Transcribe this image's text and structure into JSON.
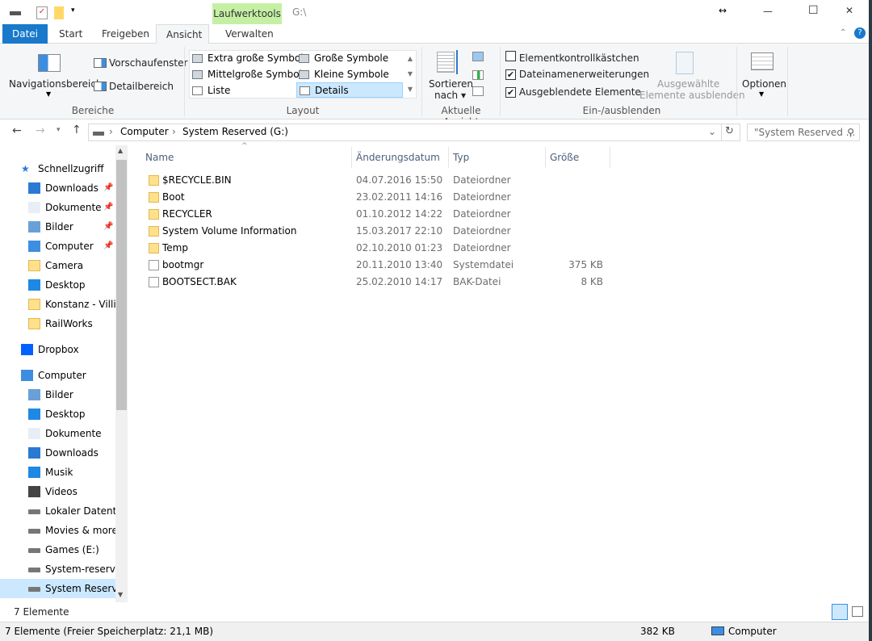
{
  "title_bar": {
    "context_tab": "Laufwerktools",
    "path": "G:\\",
    "resize_glyph": "↔",
    "minimize": "—",
    "maximize": "☐",
    "close": "✕"
  },
  "tabs": [
    {
      "label": "Datei"
    },
    {
      "label": "Start"
    },
    {
      "label": "Freigeben"
    },
    {
      "label": "Ansicht",
      "active": true
    },
    {
      "label": "Verwalten"
    }
  ],
  "ribbon": {
    "bereiche": {
      "label": "Bereiche",
      "navigationsbereich": "Navigationsbereich",
      "vorschaufenster": "Vorschaufenster",
      "detailbereich": "Detailbereich"
    },
    "layout": {
      "label": "Layout",
      "options": [
        "Extra große Symbole",
        "Große Symbole",
        "Mittelgroße Symbole",
        "Kleine Symbole",
        "Liste",
        "Details"
      ],
      "selected": "Details"
    },
    "aktuelle_ansicht": {
      "label": "Aktuelle Ansicht",
      "sortieren": "Sortieren",
      "nach": "nach ▾"
    },
    "einausblenden": {
      "label": "Ein-/ausblenden",
      "checkboxes": [
        {
          "label": "Elementkontrollkästchen",
          "checked": false
        },
        {
          "label": "Dateinamenerweiterungen",
          "checked": true
        },
        {
          "label": "Ausgeblendete Elemente",
          "checked": true
        }
      ],
      "hide_selected_1": "Ausgewählte",
      "hide_selected_2": "Elemente ausblenden"
    },
    "optionen": "Optionen"
  },
  "address": {
    "crumbs": [
      "Computer",
      "System Reserved (G:)"
    ],
    "search_placeholder": "\"System Reserved ..."
  },
  "nav": [
    {
      "label": "Schnellzugriff",
      "icon": "star-icon",
      "level": 0
    },
    {
      "label": "Downloads",
      "icon": "download-icon",
      "pinned": true
    },
    {
      "label": "Dokumente",
      "icon": "documents-icon",
      "pinned": true
    },
    {
      "label": "Bilder",
      "icon": "pictures-icon",
      "pinned": true
    },
    {
      "label": "Computer",
      "icon": "computer-icon",
      "pinned": true
    },
    {
      "label": "Camera",
      "icon": "folder-icon"
    },
    {
      "label": "Desktop",
      "icon": "desktop-icon"
    },
    {
      "label": "Konstanz - Villin",
      "icon": "folder-icon"
    },
    {
      "label": "RailWorks",
      "icon": "folder-icon"
    },
    {
      "label": "Dropbox",
      "icon": "dropbox-icon",
      "level": 0
    },
    {
      "label": "Computer",
      "icon": "computer-icon",
      "level": 0
    },
    {
      "label": "Bilder",
      "icon": "pictures-icon"
    },
    {
      "label": "Desktop",
      "icon": "desktop-icon"
    },
    {
      "label": "Dokumente",
      "icon": "documents-icon"
    },
    {
      "label": "Downloads",
      "icon": "download-icon"
    },
    {
      "label": "Musik",
      "icon": "music-icon"
    },
    {
      "label": "Videos",
      "icon": "videos-icon"
    },
    {
      "label": "Lokaler Datenträ",
      "icon": "drive-icon"
    },
    {
      "label": "Movies & more",
      "icon": "drive-icon"
    },
    {
      "label": "Games (E:)",
      "icon": "drive-icon"
    },
    {
      "label": "System-reservier",
      "icon": "drive-icon"
    },
    {
      "label": "System Reservec",
      "icon": "drive-icon",
      "selected": true
    }
  ],
  "columns": [
    "Name",
    "Änderungsdatum",
    "Typ",
    "Größe"
  ],
  "files": [
    {
      "name": "$RECYCLE.BIN",
      "date": "04.07.2016 15:50",
      "type": "Dateiordner",
      "size": "",
      "icon": "folder-icon"
    },
    {
      "name": "Boot",
      "date": "23.02.2011 14:16",
      "type": "Dateiordner",
      "size": "",
      "icon": "folder-icon"
    },
    {
      "name": "RECYCLER",
      "date": "01.10.2012 14:22",
      "type": "Dateiordner",
      "size": "",
      "icon": "folder-icon"
    },
    {
      "name": "System Volume Information",
      "date": "15.03.2017 22:10",
      "type": "Dateiordner",
      "size": "",
      "icon": "folder-icon"
    },
    {
      "name": "Temp",
      "date": "02.10.2010 01:23",
      "type": "Dateiordner",
      "size": "",
      "icon": "folder-icon"
    },
    {
      "name": "bootmgr",
      "date": "20.11.2010 13:40",
      "type": "Systemdatei",
      "size": "375 KB",
      "icon": "system-file-icon"
    },
    {
      "name": "BOOTSECT.BAK",
      "date": "25.02.2010 14:17",
      "type": "BAK-Datei",
      "size": "8 KB",
      "icon": "file-icon"
    }
  ],
  "status": {
    "count": "7 Elemente",
    "bottom": "7 Elemente (Freier Speicherplatz: 21,1 MB)",
    "size": "382 KB",
    "location": "Computer"
  }
}
